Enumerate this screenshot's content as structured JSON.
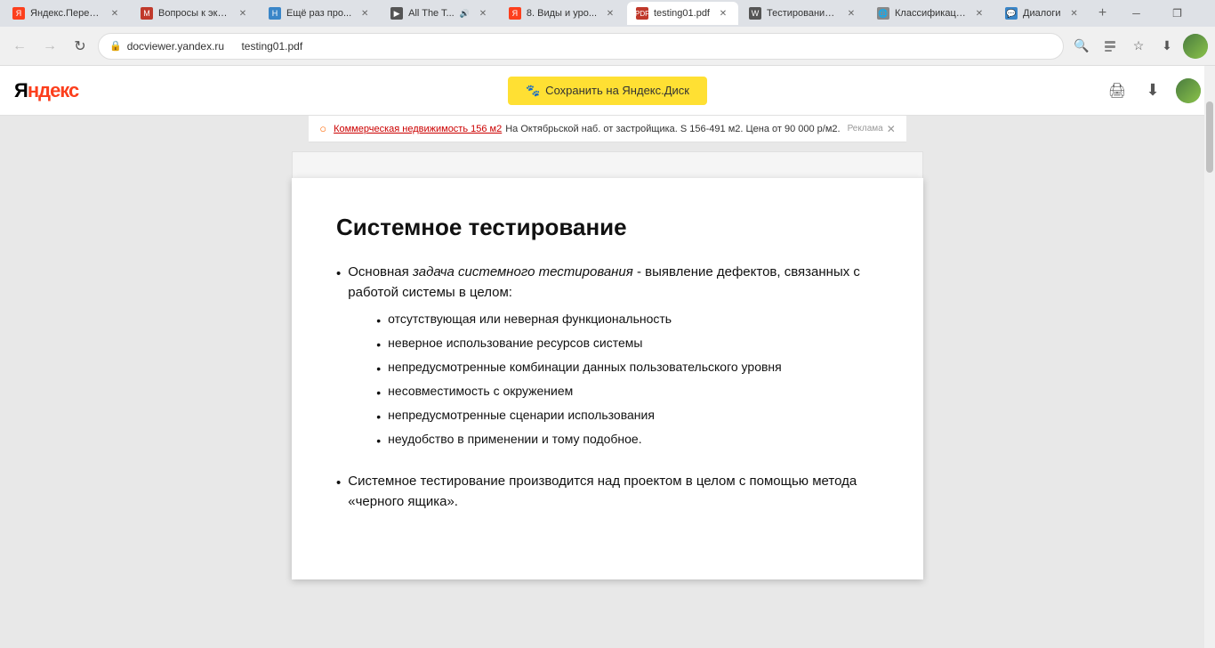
{
  "browser": {
    "tabs": [
      {
        "id": "tab1",
        "label": "Яндекс.Перев...",
        "favicon_color": "#fc3f1d",
        "favicon_text": "Я",
        "active": false,
        "audio": false
      },
      {
        "id": "tab2",
        "label": "Вопросы к экз...",
        "favicon_color": "#c0392b",
        "favicon_text": "M",
        "active": false,
        "audio": false
      },
      {
        "id": "tab3",
        "label": "Ещё раз про...",
        "favicon_color": "#3a86c8",
        "favicon_text": "Н",
        "active": false,
        "audio": false
      },
      {
        "id": "tab4",
        "label": "All The T...",
        "favicon_color": "#333",
        "favicon_text": "▶",
        "active": false,
        "audio": true
      },
      {
        "id": "tab5",
        "label": "8. Виды и уро...",
        "favicon_color": "#fc3f1d",
        "favicon_text": "Я",
        "active": false,
        "audio": false
      },
      {
        "id": "tab6",
        "label": "testing01.pdf",
        "favicon_color": "#c0392b",
        "favicon_text": "PDF",
        "active": true,
        "audio": false
      },
      {
        "id": "tab7",
        "label": "Тестирование...",
        "favicon_color": "#555",
        "favicon_text": "W",
        "active": false,
        "audio": false
      },
      {
        "id": "tab8",
        "label": "Классификаци...",
        "favicon_color": "#888",
        "favicon_text": "🌐",
        "active": false,
        "audio": false
      },
      {
        "id": "tab9",
        "label": "Диалоги",
        "favicon_color": "#3a86c8",
        "favicon_text": "💬",
        "active": false,
        "audio": false
      }
    ],
    "address": {
      "domain": "docviewer.yandex.ru",
      "path": "testing01.pdf"
    },
    "win_controls": [
      "─",
      "❐",
      "✕"
    ]
  },
  "ad": {
    "logo": "○",
    "link_text": "Коммерческая недвижимость 156 м2",
    "text": "На Октябрьской наб. от застройщика. S 156-491 м2. Цена от 90 000 р/м2.",
    "label": "Реклама"
  },
  "yandex_header": {
    "logo_text": "Яндекс",
    "save_icon": "🐾",
    "save_label": "Сохранить на Яндекс.Диск",
    "print_icon": "🖨",
    "download_icon": "⬇"
  },
  "pdf": {
    "title": "Системное тестирование",
    "main_bullets": [
      {
        "text_before_italic": "Основная ",
        "italic_text": "задача системного тестирования",
        "text_after_italic": " - выявление дефектов, связанных с работой системы в целом:",
        "sub_bullets": [
          "отсутствующая или неверная функциональность",
          "неверное использование ресурсов системы",
          "непредусмотренные комбинации данных пользовательского уровня",
          "несовместимость с окружением",
          "непредусмотренные сценарии использования",
          "неудобство в применении и тому подобное."
        ]
      },
      {
        "text_before_italic": "Системное тестирование производится над проектом в целом с помощью метода «черного ящика».",
        "italic_text": "",
        "text_after_italic": "",
        "sub_bullets": []
      }
    ]
  }
}
